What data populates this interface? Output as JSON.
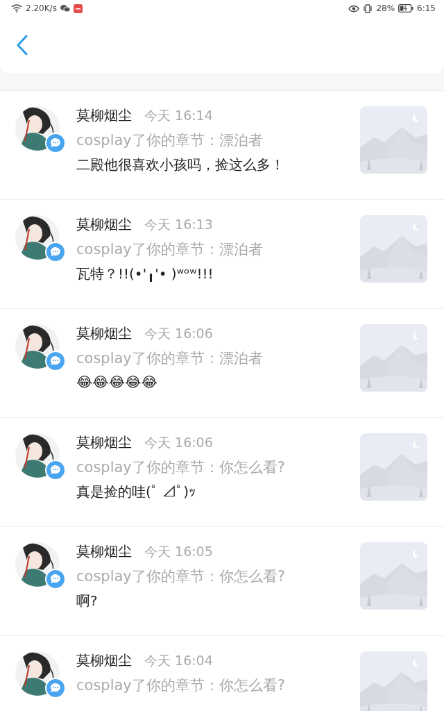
{
  "status_bar": {
    "speed": "2.20K/s",
    "battery": "28%",
    "time": "6:15"
  },
  "messages": [
    {
      "name": "莫柳烟尘",
      "time": "今天 16:14",
      "subtitle": "cosplay了你的章节：漂泊者",
      "message": "二殿他很喜欢小孩吗，捡这么多！"
    },
    {
      "name": "莫柳烟尘",
      "time": "今天 16:13",
      "subtitle": "cosplay了你的章节：漂泊者",
      "message": "瓦特？!!(•'╻'• )ʷᵒʷ!!!"
    },
    {
      "name": "莫柳烟尘",
      "time": "今天 16:06",
      "subtitle": "cosplay了你的章节：漂泊者",
      "message": "😂😂😂😂😂"
    },
    {
      "name": "莫柳烟尘",
      "time": "今天 16:06",
      "subtitle": "cosplay了你的章节：你怎么看?",
      "message": "真是捡的哇(ﾟ ⊿ﾟ)ｯ"
    },
    {
      "name": "莫柳烟尘",
      "time": "今天 16:05",
      "subtitle": "cosplay了你的章节：你怎么看?",
      "message": "啊?"
    },
    {
      "name": "莫柳烟尘",
      "time": "今天 16:04",
      "subtitle": "cosplay了你的章节：你怎么看?"
    }
  ]
}
